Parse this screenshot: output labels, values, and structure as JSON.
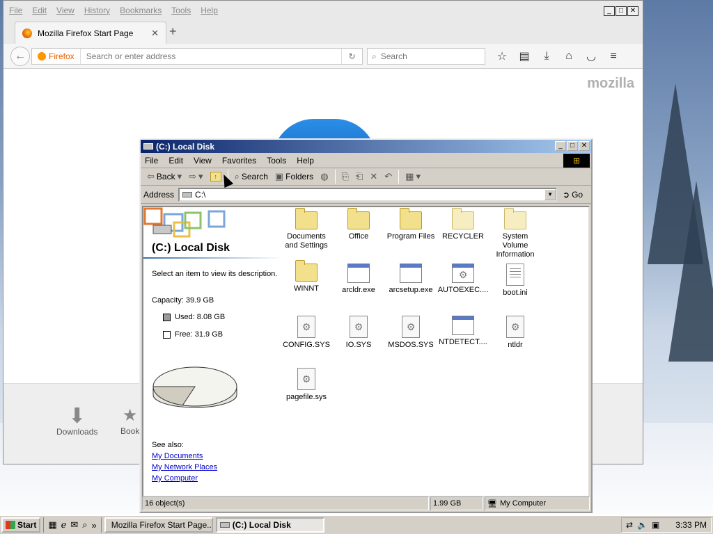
{
  "firefox": {
    "menu": [
      "File",
      "Edit",
      "View",
      "History",
      "Bookmarks",
      "Tools",
      "Help"
    ],
    "tab_title": "Mozilla Firefox Start Page",
    "identity_label": "Firefox",
    "url_placeholder": "Search or enter address",
    "search_placeholder": "Search",
    "brand_text": "mozilla",
    "downloads_label": "Downloads",
    "bookmarks_partial_label": "Book"
  },
  "explorer": {
    "title": "(C:) Local Disk",
    "menu": [
      "File",
      "Edit",
      "View",
      "Favorites",
      "Tools",
      "Help"
    ],
    "toolbar": {
      "back": "Back",
      "search": "Search",
      "folders": "Folders"
    },
    "address_label": "Address",
    "address_value": "C:\\",
    "go_label": "Go",
    "pane": {
      "title": "(C:) Local Disk",
      "description": "Select an item to view its description.",
      "capacity": "Capacity: 39.9 GB",
      "used": "Used: 8.08 GB",
      "free": "Free: 31.9 GB",
      "used_fraction": 0.2025,
      "see_also": "See also:",
      "links": [
        "My Documents",
        "My Network Places",
        "My Computer"
      ]
    },
    "items": [
      {
        "name": "Documents and Settings",
        "type": "folder"
      },
      {
        "name": "Office",
        "type": "folder"
      },
      {
        "name": "Program Files",
        "type": "folder"
      },
      {
        "name": "RECYCLER",
        "type": "folder-hidden"
      },
      {
        "name": "System Volume Information",
        "type": "folder-hidden"
      },
      {
        "name": "WINNT",
        "type": "folder"
      },
      {
        "name": "arcldr.exe",
        "type": "exe"
      },
      {
        "name": "arcsetup.exe",
        "type": "exe"
      },
      {
        "name": "AUTOEXEC....",
        "type": "exe-gear"
      },
      {
        "name": "boot.ini",
        "type": "ini"
      },
      {
        "name": "CONFIG.SYS",
        "type": "sys"
      },
      {
        "name": "IO.SYS",
        "type": "sys"
      },
      {
        "name": "MSDOS.SYS",
        "type": "sys"
      },
      {
        "name": "NTDETECT....",
        "type": "exe"
      },
      {
        "name": "ntldr",
        "type": "sys"
      },
      {
        "name": "pagefile.sys",
        "type": "sys"
      }
    ],
    "status": {
      "objects": "16 object(s)",
      "size": "1.99 GB",
      "location": "My Computer"
    }
  },
  "taskbar": {
    "start_label": "Start",
    "tasks": [
      "Mozilla Firefox Start Page...",
      "(C:) Local Disk"
    ],
    "clock": "3:33 PM"
  }
}
